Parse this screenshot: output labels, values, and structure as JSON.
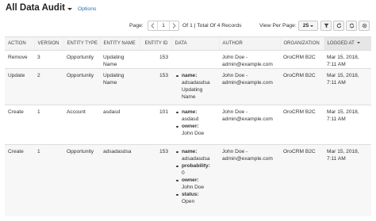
{
  "header": {
    "title": "All Data Audit",
    "options_label": "Options"
  },
  "toolbar": {
    "page_label": "Page:",
    "prev_icon": "chevron-left-icon",
    "current_page": "1",
    "next_icon": "chevron-right-icon",
    "records_text": "Of 1 | Total Of 4 Records",
    "view_per_page_label": "View Per Page:",
    "per_page_value": "25",
    "filter_icon": "filter-icon",
    "reset_icon": "reset-icon",
    "refresh_icon": "refresh-icon",
    "settings_icon": "gear-icon"
  },
  "columns": {
    "action": "ACTION",
    "version": "VERSION",
    "entity_type": "ENTITY TYPE",
    "entity_name": "ENTITY NAME",
    "entity_id": "ENTITY ID",
    "data": "DATA",
    "author": "AUTHOR",
    "organization": "ORGANIZATION",
    "logged_at": "LOGGED AT"
  },
  "rows": [
    {
      "action": "Remove",
      "version": "3",
      "entity_type": "Opportunity",
      "entity_name": "Updating Name",
      "entity_id": "153",
      "data": [],
      "author": "John Doe - admin@example.com",
      "organization": "OroCRM B2C",
      "logged_at": "Mar 15, 2018, 7:11 AM"
    },
    {
      "action": "Update",
      "version": "2",
      "entity_type": "Opportunity",
      "entity_name": "Updating Name",
      "entity_id": "153",
      "data": [
        {
          "key": "name:",
          "value": "adsadasdsa Updating Name"
        }
      ],
      "author": "John Doe - admin@example.com",
      "organization": "OroCRM B2C",
      "logged_at": "Mar 15, 2018, 7:11 AM"
    },
    {
      "action": "Create",
      "version": "1",
      "entity_type": "Account",
      "entity_name": "asdasd",
      "entity_id": "101",
      "data": [
        {
          "key": "name:",
          "value": "asdasd"
        },
        {
          "key": "owner:",
          "value": "John Doe"
        }
      ],
      "author": "John Doe - admin@example.com",
      "organization": "OroCRM B2C",
      "logged_at": "Mar 15, 2018, 7:11 AM"
    },
    {
      "action": "Create",
      "version": "1",
      "entity_type": "Opportunity",
      "entity_name": "adsadasdsa",
      "entity_id": "153",
      "data": [
        {
          "key": "name:",
          "value": "adsadasdsa"
        },
        {
          "key": "probability:",
          "value": "0"
        },
        {
          "key": "owner:",
          "value": "John Doe"
        },
        {
          "key": "status:",
          "value": "Open"
        }
      ],
      "author": "John Doe - admin@example.com",
      "organization": "OroCRM B2C",
      "logged_at": "Mar 15, 2018, 7:11 AM"
    }
  ]
}
